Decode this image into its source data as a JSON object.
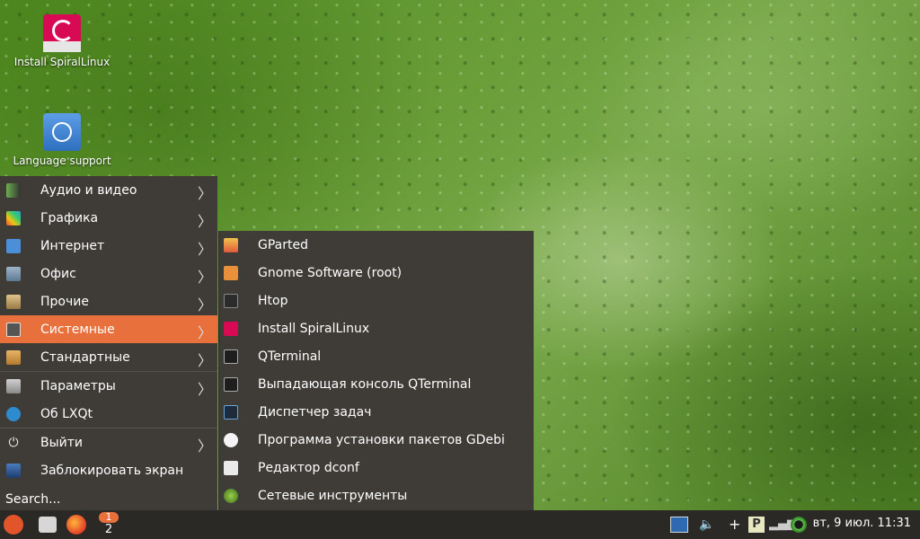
{
  "desktop": {
    "icons": [
      {
        "label": "Install SpiralLinux"
      },
      {
        "label": "Language support"
      }
    ]
  },
  "menu": {
    "items": [
      {
        "label": "Аудио и видео",
        "icon": "audio-video-icon",
        "has_submenu": true
      },
      {
        "label": "Графика",
        "icon": "graphics-icon",
        "has_submenu": true
      },
      {
        "label": "Интернет",
        "icon": "internet-icon",
        "has_submenu": true
      },
      {
        "label": "Офис",
        "icon": "office-icon",
        "has_submenu": true
      },
      {
        "label": "Прочие",
        "icon": "other-icon",
        "has_submenu": true
      },
      {
        "label": "Системные",
        "icon": "system-icon",
        "has_submenu": true,
        "active": true
      },
      {
        "label": "Стандартные",
        "icon": "accessories-icon",
        "has_submenu": true
      },
      {
        "label": "Параметры",
        "icon": "preferences-icon",
        "has_submenu": true
      },
      {
        "label": "Об LXQt",
        "icon": "lxqt-icon",
        "has_submenu": false
      },
      {
        "label": "Выйти",
        "icon": "power-icon",
        "has_submenu": true
      },
      {
        "label": "Заблокировать экран",
        "icon": "lock-screen-icon",
        "has_submenu": false
      }
    ],
    "search_label": "Search..."
  },
  "submenu": {
    "items": [
      {
        "label": "GParted",
        "icon": "gparted-icon"
      },
      {
        "label": "Gnome Software (root)",
        "icon": "gnome-software-icon"
      },
      {
        "label": "Htop",
        "icon": "htop-icon"
      },
      {
        "label": "Install SpiralLinux",
        "icon": "debian-install-icon"
      },
      {
        "label": "QTerminal",
        "icon": "terminal-icon"
      },
      {
        "label": "Выпадающая консоль QTerminal",
        "icon": "terminal-dropdown-icon"
      },
      {
        "label": "Диспетчер задач",
        "icon": "task-manager-icon"
      },
      {
        "label": "Программа установки пакетов GDebi",
        "icon": "gdebi-icon"
      },
      {
        "label": "Редактор dconf",
        "icon": "dconf-icon"
      },
      {
        "label": "Сетевые инструменты",
        "icon": "network-tools-icon"
      }
    ]
  },
  "taskbar": {
    "workspace_badge": "1",
    "workspace_number": "2",
    "clock": "вт, 9 июл. 11:31",
    "tray_plus": "+"
  },
  "colors": {
    "accent": "#e8703d",
    "menu_bg": "#3f3c38",
    "taskbar_bg": "#2b2926"
  }
}
